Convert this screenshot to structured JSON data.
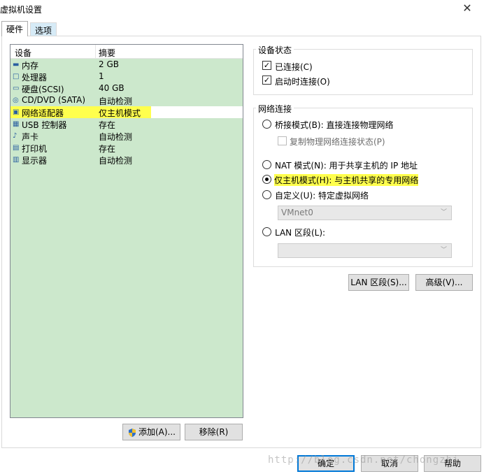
{
  "window": {
    "title": "虚拟机设置",
    "close_glyph": "✕"
  },
  "tabs": [
    {
      "label": "硬件"
    },
    {
      "label": "选项"
    }
  ],
  "device_list": {
    "headers": {
      "device": "设备",
      "summary": "摘要"
    },
    "rows": [
      {
        "icon": "memory-icon",
        "glyph": "▬",
        "device": "内存",
        "summary": "2 GB"
      },
      {
        "icon": "processor-icon",
        "glyph": "□",
        "device": "处理器",
        "summary": "1"
      },
      {
        "icon": "harddisk-icon",
        "glyph": "▭",
        "device": "硬盘(SCSI)",
        "summary": "40 GB"
      },
      {
        "icon": "cdrom-icon",
        "glyph": "◎",
        "device": "CD/DVD (SATA)",
        "summary": "自动检测"
      },
      {
        "icon": "network-adapter-icon",
        "glyph": "▣",
        "device": "网络适配器",
        "summary": "仅主机模式"
      },
      {
        "icon": "usb-icon",
        "glyph": "▦",
        "device": "USB 控制器",
        "summary": "存在"
      },
      {
        "icon": "sound-card-icon",
        "glyph": "♪",
        "device": "声卡",
        "summary": "自动检测"
      },
      {
        "icon": "printer-icon",
        "glyph": "▤",
        "device": "打印机",
        "summary": "存在"
      },
      {
        "icon": "display-icon",
        "glyph": "▥",
        "device": "显示器",
        "summary": "自动检测"
      }
    ],
    "selected_index": 4,
    "highlight_color": "#ffff4d",
    "list_bg_color": "#cce8cc"
  },
  "buttons": {
    "add": "添加(A)...",
    "remove": "移除(R)",
    "ok": "确定",
    "cancel": "取消",
    "help": "帮助",
    "lan_segments": "LAN 区段(S)...",
    "advanced": "高级(V)..."
  },
  "device_status": {
    "title": "设备状态",
    "connected": {
      "label": "已连接(C)",
      "checked": true,
      "glyph": "✓"
    },
    "connect_at_power_on": {
      "label": "启动时连接(O)",
      "checked": true,
      "glyph": "✓"
    }
  },
  "network_connection": {
    "title": "网络连接",
    "bridged": {
      "label": "桥接模式(B): 直接连接物理网络",
      "selected": false
    },
    "replicate": {
      "label": "复制物理网络连接状态(P)",
      "checked": false,
      "enabled": false
    },
    "nat": {
      "label": "NAT 模式(N): 用于共享主机的 IP 地址",
      "selected": false
    },
    "host_only": {
      "label": "仅主机模式(H): 与主机共享的专用网络",
      "selected": true
    },
    "custom": {
      "label": "自定义(U): 特定虚拟网络",
      "selected": false
    },
    "custom_select": {
      "value": "VMnet0",
      "enabled": false
    },
    "lan_segment": {
      "label": "LAN 区段(L):",
      "selected": false
    },
    "lan_select": {
      "value": "",
      "enabled": false
    }
  },
  "watermark": "http://blog.csdn.net/chongzhi",
  "colors": {
    "accent_button_border": "#0078d7",
    "inactive_tab": "#d6ebf7"
  }
}
